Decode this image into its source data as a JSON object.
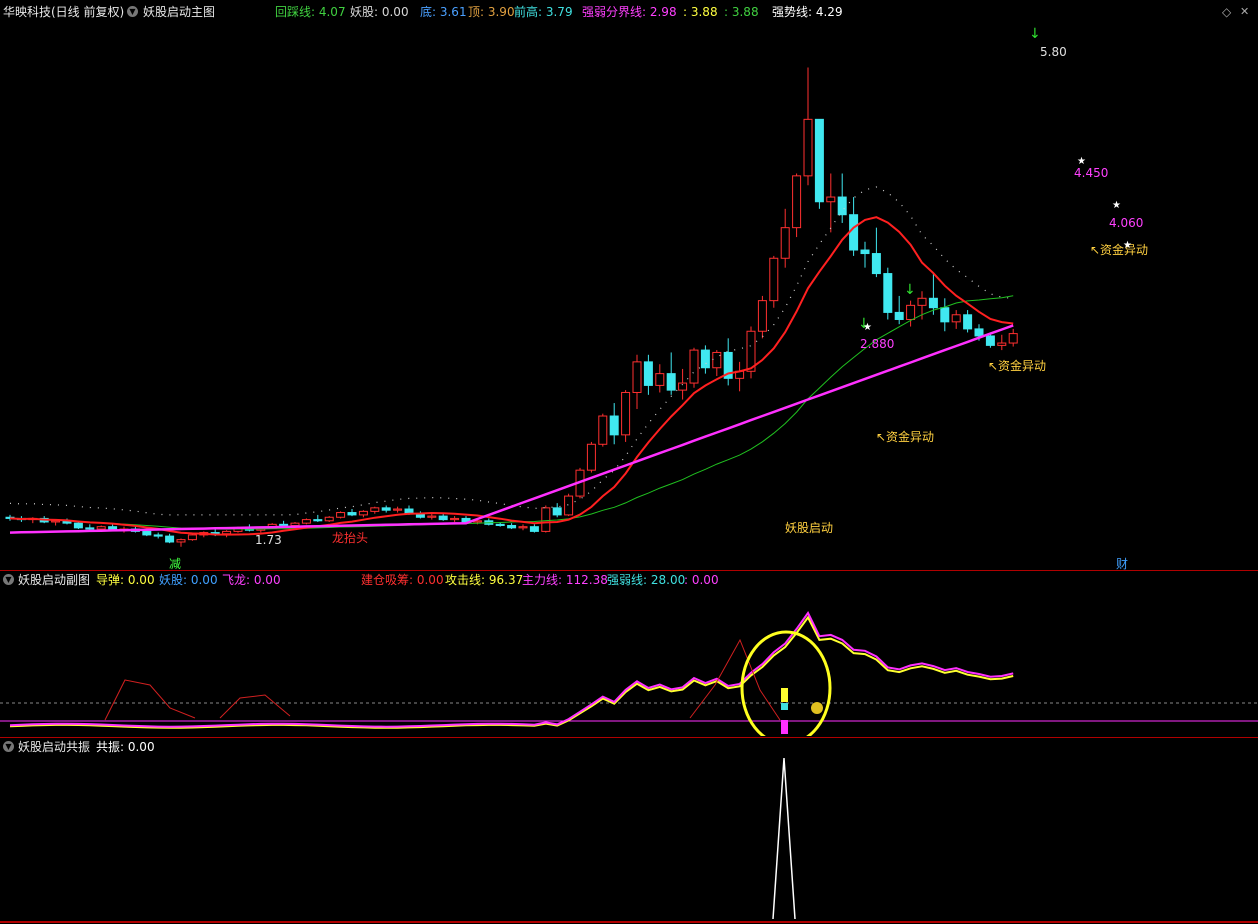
{
  "main": {
    "stock": "华映科技(日线 前复权)",
    "chart_name": "妖股启动主图",
    "legend": [
      {
        "label": "回踩线: 4.07",
        "color": "#40d040"
      },
      {
        "label": "妖股: 0.00",
        "color": "#d8d8d8"
      },
      {
        "label": "底: 3.61",
        "color": "#4aa0ff"
      },
      {
        "label": "顶: 3.90",
        "color": "#e0a040"
      },
      {
        "label": "前高: 3.79",
        "color": "#40e0e0"
      },
      {
        "label": "强弱分界线: 2.98",
        "color": "#ff40ff"
      },
      {
        "label": ": 3.88",
        "color": "#ffff40"
      },
      {
        "label": ": 3.88",
        "color": "#40d040"
      },
      {
        "label": "强势线: 4.29",
        "color": "#ffffff"
      }
    ],
    "annotations": [
      {
        "text": "5.80",
        "color": "#e0e0e0"
      },
      {
        "text": "4.450",
        "color": "#ff40ff"
      },
      {
        "text": "4.060",
        "color": "#ff40ff"
      },
      {
        "text": "2.880",
        "color": "#ff40ff"
      },
      {
        "text": "1.73",
        "color": "#e0e0e0"
      },
      {
        "text": "↖资金异动",
        "color": "#ffd040"
      },
      {
        "text": "↖资金异动",
        "color": "#ffd040"
      },
      {
        "text": "↖资金异动",
        "color": "#ffd040"
      },
      {
        "text": "龙抬头",
        "color": "#ff3030"
      },
      {
        "text": "妖股启动",
        "color": "#ffd040"
      },
      {
        "text": "减",
        "color": "#40ff40"
      },
      {
        "text": "财",
        "color": "#40a0ff"
      }
    ]
  },
  "sub1": {
    "chart_name": "妖股启动副图",
    "legend": [
      {
        "label": "导弹: 0.00",
        "color": "#ffff40"
      },
      {
        "label": "妖股: 0.00",
        "color": "#40a0ff"
      },
      {
        "label": "飞龙: 0.00",
        "color": "#ff40ff"
      },
      {
        "label": "建仓吸筹: 0.00",
        "color": "#ff3030"
      },
      {
        "label": "攻击线: 96.37",
        "color": "#ffff40"
      },
      {
        "label": "主力线: 112.38",
        "color": "#ff40ff"
      },
      {
        "label": "强弱线: 28.00",
        "color": "#40e0e0"
      },
      {
        "label": ": 0.00",
        "color": "#ff40ff"
      }
    ]
  },
  "sub2": {
    "chart_name": "妖股启动共振",
    "legend": [
      {
        "label": "共振: 0.00",
        "color": "#ffffff"
      }
    ]
  },
  "colors": {
    "up": "#ff3030",
    "down": "#40e8f0",
    "ma_red": "#ff2020",
    "ma_green": "#20c020",
    "ma_magenta": "#ff30ff"
  },
  "chart_data": [
    {
      "type": "candlestick",
      "title": "妖股启动主图",
      "ylim": [
        1.6,
        6.0
      ],
      "candles": [
        [
          1.98,
          2.0,
          1.95,
          1.97
        ],
        [
          1.97,
          1.99,
          1.94,
          1.96
        ],
        [
          1.96,
          1.98,
          1.93,
          1.97
        ],
        [
          1.97,
          1.99,
          1.93,
          1.94
        ],
        [
          1.94,
          1.96,
          1.91,
          1.95
        ],
        [
          1.95,
          1.97,
          1.92,
          1.93
        ],
        [
          1.93,
          1.95,
          1.88,
          1.89
        ],
        [
          1.89,
          1.92,
          1.87,
          1.88
        ],
        [
          1.88,
          1.91,
          1.86,
          1.9
        ],
        [
          1.9,
          1.92,
          1.86,
          1.87
        ],
        [
          1.87,
          1.9,
          1.85,
          1.88
        ],
        [
          1.88,
          1.9,
          1.85,
          1.86
        ],
        [
          1.86,
          1.88,
          1.82,
          1.83
        ],
        [
          1.83,
          1.85,
          1.8,
          1.82
        ],
        [
          1.82,
          1.84,
          1.76,
          1.77
        ],
        [
          1.77,
          1.8,
          1.73,
          1.79
        ],
        [
          1.79,
          1.84,
          1.78,
          1.83
        ],
        [
          1.83,
          1.86,
          1.81,
          1.85
        ],
        [
          1.85,
          1.88,
          1.82,
          1.84
        ],
        [
          1.84,
          1.87,
          1.81,
          1.86
        ],
        [
          1.86,
          1.9,
          1.85,
          1.89
        ],
        [
          1.89,
          1.92,
          1.86,
          1.87
        ],
        [
          1.87,
          1.9,
          1.85,
          1.89
        ],
        [
          1.89,
          1.93,
          1.88,
          1.92
        ],
        [
          1.92,
          1.95,
          1.9,
          1.91
        ],
        [
          1.91,
          1.94,
          1.89,
          1.93
        ],
        [
          1.93,
          1.97,
          1.92,
          1.96
        ],
        [
          1.96,
          2.0,
          1.94,
          1.95
        ],
        [
          1.95,
          1.99,
          1.94,
          1.98
        ],
        [
          1.98,
          2.03,
          1.97,
          2.02
        ],
        [
          2.02,
          2.05,
          1.99,
          2.0
        ],
        [
          2.0,
          2.04,
          1.98,
          2.03
        ],
        [
          2.03,
          2.07,
          2.01,
          2.06
        ],
        [
          2.06,
          2.08,
          2.02,
          2.04
        ],
        [
          2.04,
          2.07,
          2.02,
          2.05
        ],
        [
          2.05,
          2.08,
          2.0,
          2.01
        ],
        [
          2.01,
          2.03,
          1.97,
          1.98
        ],
        [
          1.98,
          2.01,
          1.96,
          1.99
        ],
        [
          1.99,
          2.01,
          1.95,
          1.96
        ],
        [
          1.96,
          1.99,
          1.94,
          1.97
        ],
        [
          1.97,
          1.99,
          1.93,
          1.94
        ],
        [
          1.94,
          1.96,
          1.92,
          1.95
        ],
        [
          1.95,
          1.97,
          1.91,
          1.92
        ],
        [
          1.92,
          1.94,
          1.9,
          1.91
        ],
        [
          1.91,
          1.93,
          1.88,
          1.89
        ],
        [
          1.89,
          1.92,
          1.87,
          1.9
        ],
        [
          1.9,
          1.92,
          1.85,
          1.86
        ],
        [
          1.86,
          2.08,
          1.85,
          2.06
        ],
        [
          2.06,
          2.1,
          1.98,
          2.0
        ],
        [
          2.0,
          2.18,
          1.99,
          2.16
        ],
        [
          2.16,
          2.4,
          2.14,
          2.38
        ],
        [
          2.38,
          2.62,
          2.36,
          2.6
        ],
        [
          2.6,
          2.86,
          2.58,
          2.84
        ],
        [
          2.84,
          2.95,
          2.6,
          2.68
        ],
        [
          2.68,
          3.06,
          2.62,
          3.04
        ],
        [
          3.04,
          3.36,
          2.9,
          3.3
        ],
        [
          3.3,
          3.36,
          3.02,
          3.1
        ],
        [
          3.1,
          3.28,
          3.04,
          3.2
        ],
        [
          3.2,
          3.38,
          3.02,
          3.06
        ],
        [
          3.06,
          3.24,
          2.98,
          3.12
        ],
        [
          3.12,
          3.42,
          3.08,
          3.4
        ],
        [
          3.4,
          3.44,
          3.2,
          3.25
        ],
        [
          3.25,
          3.4,
          3.18,
          3.38
        ],
        [
          3.38,
          3.5,
          3.1,
          3.16
        ],
        [
          3.16,
          3.3,
          3.05,
          3.22
        ],
        [
          3.22,
          3.6,
          3.16,
          3.56
        ],
        [
          3.56,
          3.86,
          3.5,
          3.82
        ],
        [
          3.82,
          4.2,
          3.76,
          4.18
        ],
        [
          4.18,
          4.6,
          4.1,
          4.44
        ],
        [
          4.44,
          4.9,
          4.36,
          4.88
        ],
        [
          4.88,
          5.8,
          4.8,
          5.36
        ],
        [
          5.36,
          5.36,
          4.6,
          4.66
        ],
        [
          4.66,
          4.9,
          4.4,
          4.7
        ],
        [
          4.7,
          4.9,
          4.48,
          4.55
        ],
        [
          4.55,
          4.7,
          4.2,
          4.25
        ],
        [
          4.25,
          4.32,
          4.1,
          4.22
        ],
        [
          4.22,
          4.44,
          4.02,
          4.05
        ],
        [
          4.05,
          4.1,
          3.66,
          3.72
        ],
        [
          3.72,
          3.86,
          3.62,
          3.66
        ],
        [
          3.66,
          3.82,
          3.6,
          3.78
        ],
        [
          3.78,
          3.9,
          3.66,
          3.84
        ],
        [
          3.84,
          4.05,
          3.7,
          3.76
        ],
        [
          3.76,
          3.84,
          3.56,
          3.64
        ],
        [
          3.64,
          3.74,
          3.58,
          3.7
        ],
        [
          3.7,
          3.74,
          3.55,
          3.58
        ],
        [
          3.58,
          3.62,
          3.48,
          3.52
        ],
        [
          3.52,
          3.54,
          3.42,
          3.44
        ],
        [
          3.44,
          3.53,
          3.4,
          3.46
        ],
        [
          3.46,
          3.58,
          3.43,
          3.54
        ]
      ]
    },
    {
      "type": "line",
      "title": "妖股启动副图",
      "ylim": [
        0,
        150
      ]
    },
    {
      "type": "line",
      "title": "妖股启动共振",
      "ylim": [
        0,
        100
      ]
    }
  ]
}
